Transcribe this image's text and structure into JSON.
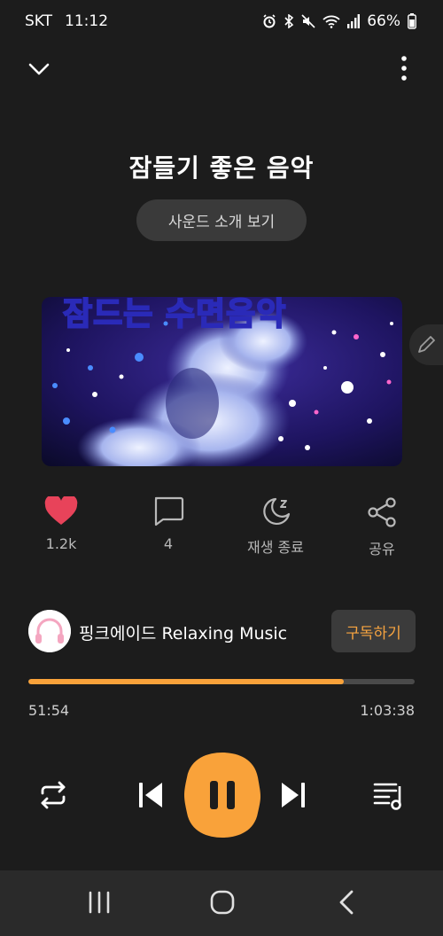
{
  "status_bar": {
    "carrier": "SKT",
    "time": "11:12",
    "battery": "66%",
    "icons": [
      "alarm-icon",
      "bluetooth-icon",
      "mute-icon",
      "wifi-icon",
      "signal-icon",
      "battery-icon"
    ]
  },
  "header": {
    "collapse_icon": "chevron-down-icon",
    "more_icon": "more-vertical-icon"
  },
  "title": "잠들기 좋은 음악",
  "intro_button": "사운드 소개 보기",
  "artwork": {
    "overlay_text": "잠드는 수면음악"
  },
  "actions": {
    "like": {
      "label": "1.2k",
      "icon": "heart-icon",
      "color": "#e8435a"
    },
    "comment": {
      "label": "4",
      "icon": "comment-icon"
    },
    "sleep": {
      "label": "재생 종료",
      "icon": "sleep-moon-icon"
    },
    "share": {
      "label": "공유",
      "icon": "share-icon"
    }
  },
  "channel": {
    "name": "핑크에이드 Relaxing Music",
    "subscribe_label": "구독하기"
  },
  "progress": {
    "current": "51:54",
    "total": "1:03:38",
    "fraction": 0.816
  },
  "controls": {
    "repeat_icon": "repeat-icon",
    "prev_icon": "skip-previous-icon",
    "play_icon": "pause-icon",
    "next_icon": "skip-next-icon",
    "queue_icon": "playlist-icon"
  },
  "colors": {
    "accent": "#f9a23a",
    "background": "#1c1c1c"
  }
}
